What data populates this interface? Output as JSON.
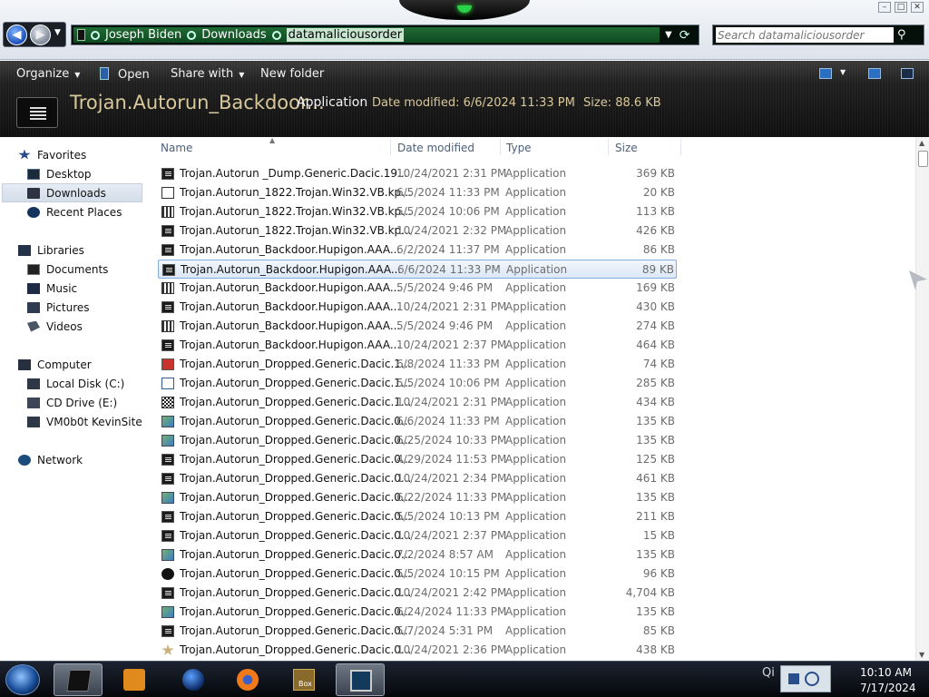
{
  "window": {
    "breadcrumb": [
      "Joseph Biden",
      "Downloads",
      "datamaliciousorder"
    ],
    "search_placeholder": "Search datamaliciousorder"
  },
  "commands": {
    "organize": "Organize",
    "open": "Open",
    "share_with": "Share with",
    "new_folder": "New folder"
  },
  "details": {
    "name": "Trojan.Autorun_Backdoor...",
    "type": "Application",
    "modified_label": "Date modified: 6/6/2024 11:33 PM",
    "size_label": "Size: 88.6 KB"
  },
  "nav": {
    "favorites": "Favorites",
    "desktop": "Desktop",
    "downloads": "Downloads",
    "recent": "Recent Places",
    "libraries": "Libraries",
    "documents": "Documents",
    "music": "Music",
    "pictures": "Pictures",
    "videos": "Videos",
    "computer": "Computer",
    "local_disk": "Local Disk (C:)",
    "cd_drive": "CD Drive (E:)",
    "share": "VM0b0t KevinSite",
    "network": "Network"
  },
  "columns": {
    "name": "Name",
    "date": "Date modified",
    "type": "Type",
    "size": "Size"
  },
  "files": [
    {
      "icon": "fi-app",
      "name": "Trojan.Autorun _Dump.Generic.Dacic.19...",
      "date": "10/24/2021 2:31 PM",
      "type": "Application",
      "size": "369 KB"
    },
    {
      "icon": "fi-shortcut",
      "name": "Trojan.Autorun_1822.Trojan.Win32.VB.kp...",
      "date": "6/5/2024 11:33 PM",
      "type": "Application",
      "size": "20 KB"
    },
    {
      "icon": "fi-grid",
      "name": "Trojan.Autorun_1822.Trojan.Win32.VB.kp...",
      "date": "5/5/2024 10:06 PM",
      "type": "Application",
      "size": "113 KB"
    },
    {
      "icon": "fi-app",
      "name": "Trojan.Autorun_1822.Trojan.Win32.VB.kp...",
      "date": "10/24/2021 2:32 PM",
      "type": "Application",
      "size": "426 KB"
    },
    {
      "icon": "fi-app",
      "name": "Trojan.Autorun_Backdoor.Hupigon.AAA...",
      "date": "6/2/2024 11:37 PM",
      "type": "Application",
      "size": "86 KB"
    },
    {
      "icon": "fi-app",
      "name": "Trojan.Autorun_Backdoor.Hupigon.AAA...",
      "date": "6/6/2024 11:33 PM",
      "type": "Application",
      "size": "89 KB",
      "selected": true
    },
    {
      "icon": "fi-grid",
      "name": "Trojan.Autorun_Backdoor.Hupigon.AAA...",
      "date": "5/5/2024 9:46 PM",
      "type": "Application",
      "size": "169 KB"
    },
    {
      "icon": "fi-app",
      "name": "Trojan.Autorun_Backdoor.Hupigon.AAA...",
      "date": "10/24/2021 2:31 PM",
      "type": "Application",
      "size": "430 KB"
    },
    {
      "icon": "fi-grid",
      "name": "Trojan.Autorun_Backdoor.Hupigon.AAA...",
      "date": "5/5/2024 9:46 PM",
      "type": "Application",
      "size": "274 KB"
    },
    {
      "icon": "fi-app",
      "name": "Trojan.Autorun_Backdoor.Hupigon.AAA...",
      "date": "10/24/2021 2:37 PM",
      "type": "Application",
      "size": "464 KB"
    },
    {
      "icon": "fi-red",
      "name": "Trojan.Autorun_Dropped.Generic.Dacic.1...",
      "date": "6/8/2024 11:33 PM",
      "type": "Application",
      "size": "74 KB"
    },
    {
      "icon": "fi-window",
      "name": "Trojan.Autorun_Dropped.Generic.Dacic.1...",
      "date": "5/5/2024 10:06 PM",
      "type": "Application",
      "size": "285 KB"
    },
    {
      "icon": "fi-qr",
      "name": "Trojan.Autorun_Dropped.Generic.Dacic.1...",
      "date": "10/24/2021 2:31 PM",
      "type": "Application",
      "size": "434 KB"
    },
    {
      "icon": "fi-setup",
      "name": "Trojan.Autorun_Dropped.Generic.Dacic.0...",
      "date": "6/6/2024 11:33 PM",
      "type": "Application",
      "size": "135 KB"
    },
    {
      "icon": "fi-setup",
      "name": "Trojan.Autorun_Dropped.Generic.Dacic.0...",
      "date": "6/25/2024 10:33 PM",
      "type": "Application",
      "size": "135 KB"
    },
    {
      "icon": "fi-app",
      "name": "Trojan.Autorun_Dropped.Generic.Dacic.0...",
      "date": "4/29/2024 11:53 PM",
      "type": "Application",
      "size": "125 KB"
    },
    {
      "icon": "fi-app",
      "name": "Trojan.Autorun_Dropped.Generic.Dacic.0...",
      "date": "10/24/2021 2:34 PM",
      "type": "Application",
      "size": "461 KB"
    },
    {
      "icon": "fi-setup",
      "name": "Trojan.Autorun_Dropped.Generic.Dacic.0...",
      "date": "6/22/2024 11:33 PM",
      "type": "Application",
      "size": "135 KB"
    },
    {
      "icon": "fi-app",
      "name": "Trojan.Autorun_Dropped.Generic.Dacic.0...",
      "date": "5/5/2024 10:13 PM",
      "type": "Application",
      "size": "211 KB"
    },
    {
      "icon": "fi-app",
      "name": "Trojan.Autorun_Dropped.Generic.Dacic.0...",
      "date": "10/24/2021 2:37 PM",
      "type": "Application",
      "size": "15 KB"
    },
    {
      "icon": "fi-setup",
      "name": "Trojan.Autorun_Dropped.Generic.Dacic.0...",
      "date": "7/2/2024 8:57 AM",
      "type": "Application",
      "size": "135 KB"
    },
    {
      "icon": "fi-circle",
      "name": "Trojan.Autorun_Dropped.Generic.Dacic.0...",
      "date": "5/5/2024 10:15 PM",
      "type": "Application",
      "size": "96 KB"
    },
    {
      "icon": "fi-app",
      "name": "Trojan.Autorun_Dropped.Generic.Dacic.0...",
      "date": "10/24/2021 2:42 PM",
      "type": "Application",
      "size": "4,704 KB"
    },
    {
      "icon": "fi-setup",
      "name": "Trojan.Autorun_Dropped.Generic.Dacic.0...",
      "date": "6/24/2024 11:33 PM",
      "type": "Application",
      "size": "135 KB"
    },
    {
      "icon": "fi-app",
      "name": "Trojan.Autorun_Dropped.Generic.Dacic.0...",
      "date": "5/7/2024 5:31 PM",
      "type": "Application",
      "size": "85 KB"
    },
    {
      "icon": "fi-star",
      "name": "Trojan.Autorun_Dropped.Generic.Dacic.0...",
      "date": "10/24/2021 2:36 PM",
      "type": "Application",
      "size": "438 KB"
    }
  ],
  "taskbar": {
    "tray_label": "Qi",
    "sandbox_label": "Box",
    "time": "10:10 AM",
    "date": "7/17/2024"
  }
}
